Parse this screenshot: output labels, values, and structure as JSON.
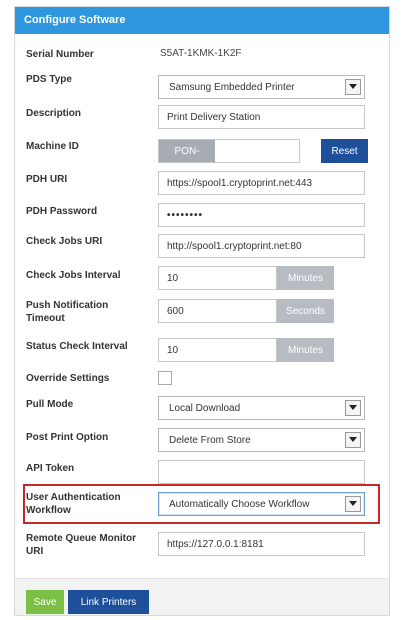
{
  "header": {
    "title": "Configure Software"
  },
  "form": {
    "serial_number": {
      "label": "Serial Number",
      "value": "S5AT-1KMK-1K2F"
    },
    "pds_type": {
      "label": "PDS Type",
      "value": "Samsung Embedded Printer"
    },
    "description": {
      "label": "Description",
      "value": "Print Delivery Station"
    },
    "machine_id": {
      "label": "Machine ID",
      "toggle_text": "PON-",
      "reset_label": "Reset"
    },
    "pdh_uri": {
      "label": "PDH URI",
      "value": "https://spool1.cryptoprint.net:443"
    },
    "pdh_password": {
      "label": "PDH Password",
      "value": "••••••••"
    },
    "check_jobs_uri": {
      "label": "Check Jobs URI",
      "value": "http://spool1.cryptoprint.net:80"
    },
    "check_jobs_interval": {
      "label": "Check Jobs Interval",
      "value": "10",
      "unit": "Minutes"
    },
    "push_notification_timeout": {
      "label": "Push Notification Timeout",
      "value": "600",
      "unit": "Seconds"
    },
    "status_check_interval": {
      "label": "Status Check Interval",
      "value": "10",
      "unit": "Minutes"
    },
    "override_settings": {
      "label": "Override Settings",
      "checked": false
    },
    "pull_mode": {
      "label": "Pull Mode",
      "value": "Local Download"
    },
    "post_print_option": {
      "label": "Post Print Option",
      "value": "Delete From Store"
    },
    "api_token": {
      "label": "API Token",
      "value": ""
    },
    "user_authentication_workflow": {
      "label": "User Authentication Workflow",
      "value": "Automatically Choose Workflow"
    },
    "remote_queue_monitor_uri": {
      "label": "Remote Queue Monitor URI",
      "value": "https://127.0.0.1:8181"
    }
  },
  "footer": {
    "save_label": "Save",
    "link_printers_label": "Link Printers"
  },
  "colors": {
    "header": "#2f97df",
    "primary_button": "#1d4f9b",
    "save_button": "#7bc043",
    "highlight_box": "#c62828"
  },
  "icons": {
    "select_arrow": "caret-down-icon"
  }
}
